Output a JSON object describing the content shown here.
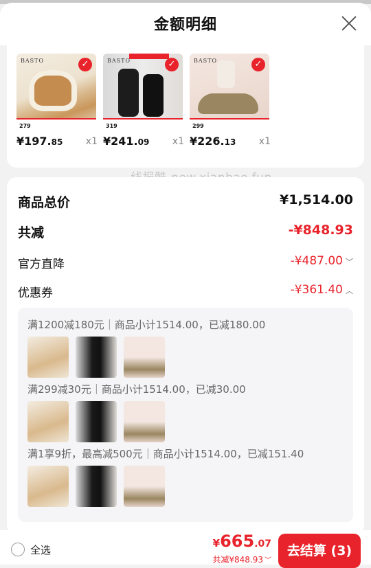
{
  "header": {
    "title": "金额明细"
  },
  "products": [
    {
      "brand": "BASTO",
      "tag": "279",
      "price_main": "¥197.",
      "price_cents": "85",
      "qty": "x1"
    },
    {
      "brand": "BASTO",
      "tag": "319",
      "price_main": "¥241.",
      "price_cents": "09",
      "qty": "x1"
    },
    {
      "brand": "BASTO",
      "tag": "299",
      "price_main": "¥226.",
      "price_cents": "13",
      "qty": "x1"
    }
  ],
  "watermark": "线报酷-new.xianbao.fun",
  "summary": {
    "total_label": "商品总价",
    "total_value": "¥1,514.00",
    "discount_label": "共减",
    "discount_value": "-¥848.93",
    "official_label": "官方直降",
    "official_value": "-¥487.00",
    "coupon_label": "优惠券",
    "coupon_value": "-¥361.40"
  },
  "coupons": [
    {
      "text": "满1200减180元｜商品小计1514.00，已减180.00"
    },
    {
      "text": "满299减30元｜商品小计1514.00，已减30.00"
    },
    {
      "text": "满1享9折，最高减500元｜商品小计1514.00，已减151.40"
    }
  ],
  "thumb_tags": [
    "279",
    "319",
    "299"
  ],
  "bottom": {
    "select_all": "全选",
    "currency": "¥",
    "amount": "665",
    "cents": ".07",
    "saved": "共减¥848.93",
    "checkout": "去结算 (3)"
  },
  "colors": {
    "accent": "#e8232b"
  },
  "icons": {
    "close": "close-icon",
    "check": "check-icon",
    "chevron": "chevron-icon"
  }
}
